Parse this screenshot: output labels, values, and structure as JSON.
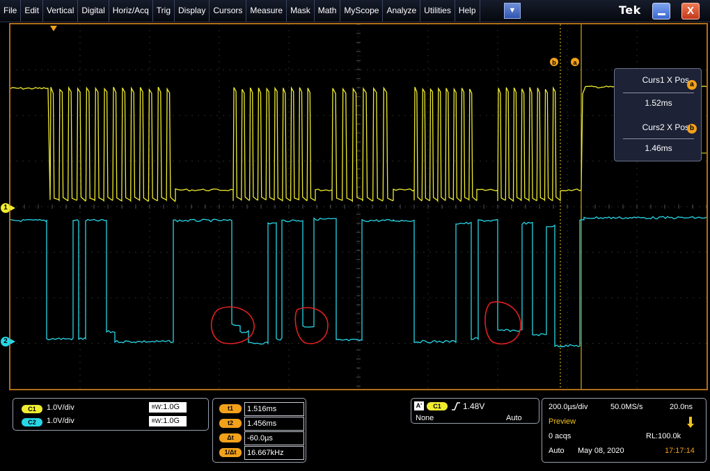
{
  "menu": {
    "items": [
      "File",
      "Edit",
      "Vertical",
      "Digital",
      "Horiz/Acq",
      "Trig",
      "Display",
      "Cursors",
      "Measure",
      "Mask",
      "Math",
      "MyScope",
      "Analyze",
      "Utilities",
      "Help"
    ],
    "dropdown_glyph": "▼",
    "dropdown_icon": "chevron-down-icon"
  },
  "brand": "Tek",
  "window": {
    "minimize_icon": "minimize-icon",
    "close_glyph": "X",
    "close_icon": "close-icon"
  },
  "display": {
    "ch1_marker": "1",
    "ch2_marker": "2",
    "cursor_a_tag": "a",
    "cursor_b_tag": "b",
    "colors": {
      "ch1": "#f0ec30",
      "ch2": "#28d6e6",
      "cursor": "#f2a11b",
      "annotation": "#e02020"
    }
  },
  "cursor_readout": {
    "curs1_label": "Curs1 X Pos",
    "curs1_badge": "a",
    "curs1_value": "1.52ms",
    "curs2_label": "Curs2 X Pos",
    "curs2_badge": "b",
    "curs2_value": "1.46ms"
  },
  "channels": {
    "c1": {
      "pill": "C1",
      "scale": "1.0V/div",
      "bw_prefix": "B",
      "bw_sub": "W",
      "bw_value": ":1.0G"
    },
    "c2": {
      "pill": "C2",
      "scale": "1.0V/div",
      "bw_prefix": "B",
      "bw_sub": "W",
      "bw_value": ":1.0G"
    }
  },
  "time_cursors": [
    {
      "label": "t1",
      "value": "1.516ms"
    },
    {
      "label": "t2",
      "value": "1.456ms"
    },
    {
      "label": "Δt",
      "value": "-60.0µs"
    },
    {
      "label": "1/Δt",
      "value": "16.667kHz"
    }
  ],
  "trigger": {
    "badge": "A'",
    "source": "C1",
    "slope_icon": "rising-edge-icon",
    "level": "1.48V",
    "mode_left": "None",
    "mode_right": "Auto"
  },
  "acquisition": {
    "timebase": "200.0µs/div",
    "sample_rate": "50.0MS/s",
    "resolution": "20.0ns",
    "status": "Preview",
    "status_icon": "trigger-arm-icon",
    "acqs": "0 acqs",
    "record_length": "RL:100.0k",
    "mode": "Auto",
    "date": "May 08, 2020",
    "time": "17:17:14"
  }
}
